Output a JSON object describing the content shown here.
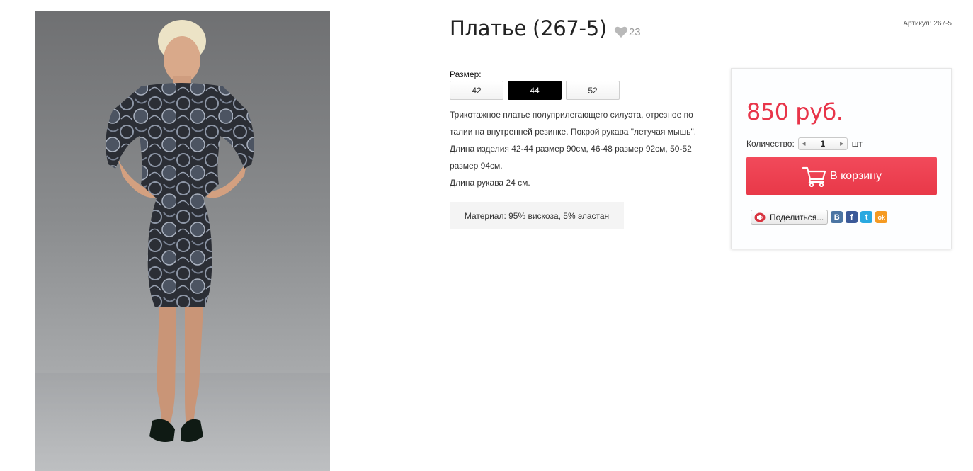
{
  "product": {
    "title": "Платье (267-5)",
    "likes_count": "23",
    "sku_label": "Артикул:",
    "sku_value": "267-5"
  },
  "sizes": {
    "label": "Размер:",
    "options": [
      "42",
      "44",
      "52"
    ],
    "selected": "44"
  },
  "description": {
    "line1": "Трикотажное платье полуприлегающего силуэта,  отрезное по талии на внутренней резинке. Покрой рукава  \"летучая мышь\".",
    "line2": "Длина изделия 42-44 размер  90см, 46-48 размер 92см, 50-52 размер  94см.",
    "line3": "Длина рукава   24 см."
  },
  "material": "Материал: 95% вискоза, 5% эластан",
  "buy": {
    "price": "850 руб.",
    "quantity_label": "Количество:",
    "quantity_value": "1",
    "quantity_unit": "шт",
    "cart_label": "В корзину"
  },
  "share": {
    "label": "Поделиться...",
    "networks": [
      {
        "name": "vk-icon",
        "glyph": "B",
        "color": "#4c75a3"
      },
      {
        "name": "facebook-icon",
        "glyph": "f",
        "color": "#3b5998"
      },
      {
        "name": "twitter-icon",
        "glyph": "t",
        "color": "#2aa9e0"
      },
      {
        "name": "odnoklassniki-icon",
        "glyph": "ok",
        "color": "#f59a22"
      }
    ]
  },
  "colors": {
    "accent": "#e8354a",
    "selected_size_bg": "#000000"
  }
}
